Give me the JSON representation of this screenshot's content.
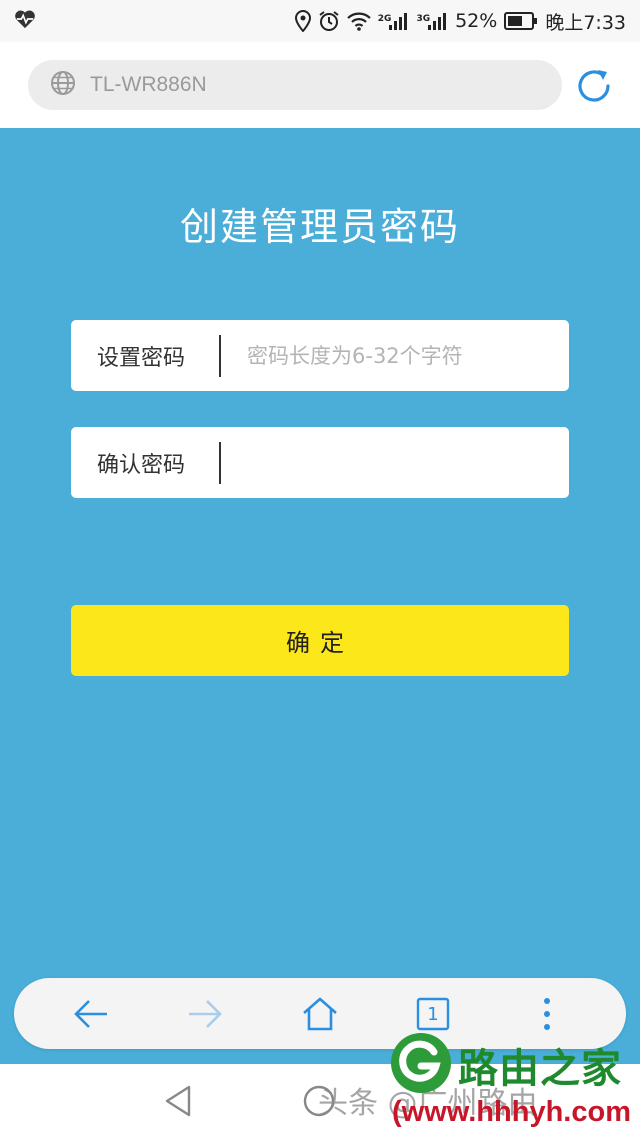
{
  "status_bar": {
    "battery": "52%",
    "time": "晚上7:33",
    "net_2g": "2G",
    "net_3g": "3G",
    "icons": [
      "heartbeat-icon",
      "location-icon",
      "alarm-icon",
      "wifi-icon",
      "signal-icon",
      "battery-icon"
    ]
  },
  "address_bar": {
    "url": "TL-WR886N",
    "icons": [
      "globe-icon",
      "refresh-icon"
    ]
  },
  "page": {
    "title": "创建管理员密码",
    "password_field": {
      "label": "设置密码",
      "placeholder": "密码长度为6-32个字符",
      "value": ""
    },
    "confirm_field": {
      "label": "确认密码",
      "placeholder": "",
      "value": ""
    },
    "confirm_button": "确定"
  },
  "toolbar": {
    "tab_count": "1",
    "icons": [
      "back-arrow-icon",
      "forward-arrow-icon",
      "home-icon",
      "tabs-icon",
      "more-icon"
    ]
  },
  "watermark": {
    "toutiao": "头条 @广州路由",
    "brand": "路由之家",
    "url": "(www.hhhyh.com"
  },
  "colors": {
    "background": "#4aaed9",
    "button": "#fbe71a",
    "accent": "#2a8fe0",
    "brand_green": "#1f8a2d",
    "brand_red": "#c7162a"
  }
}
